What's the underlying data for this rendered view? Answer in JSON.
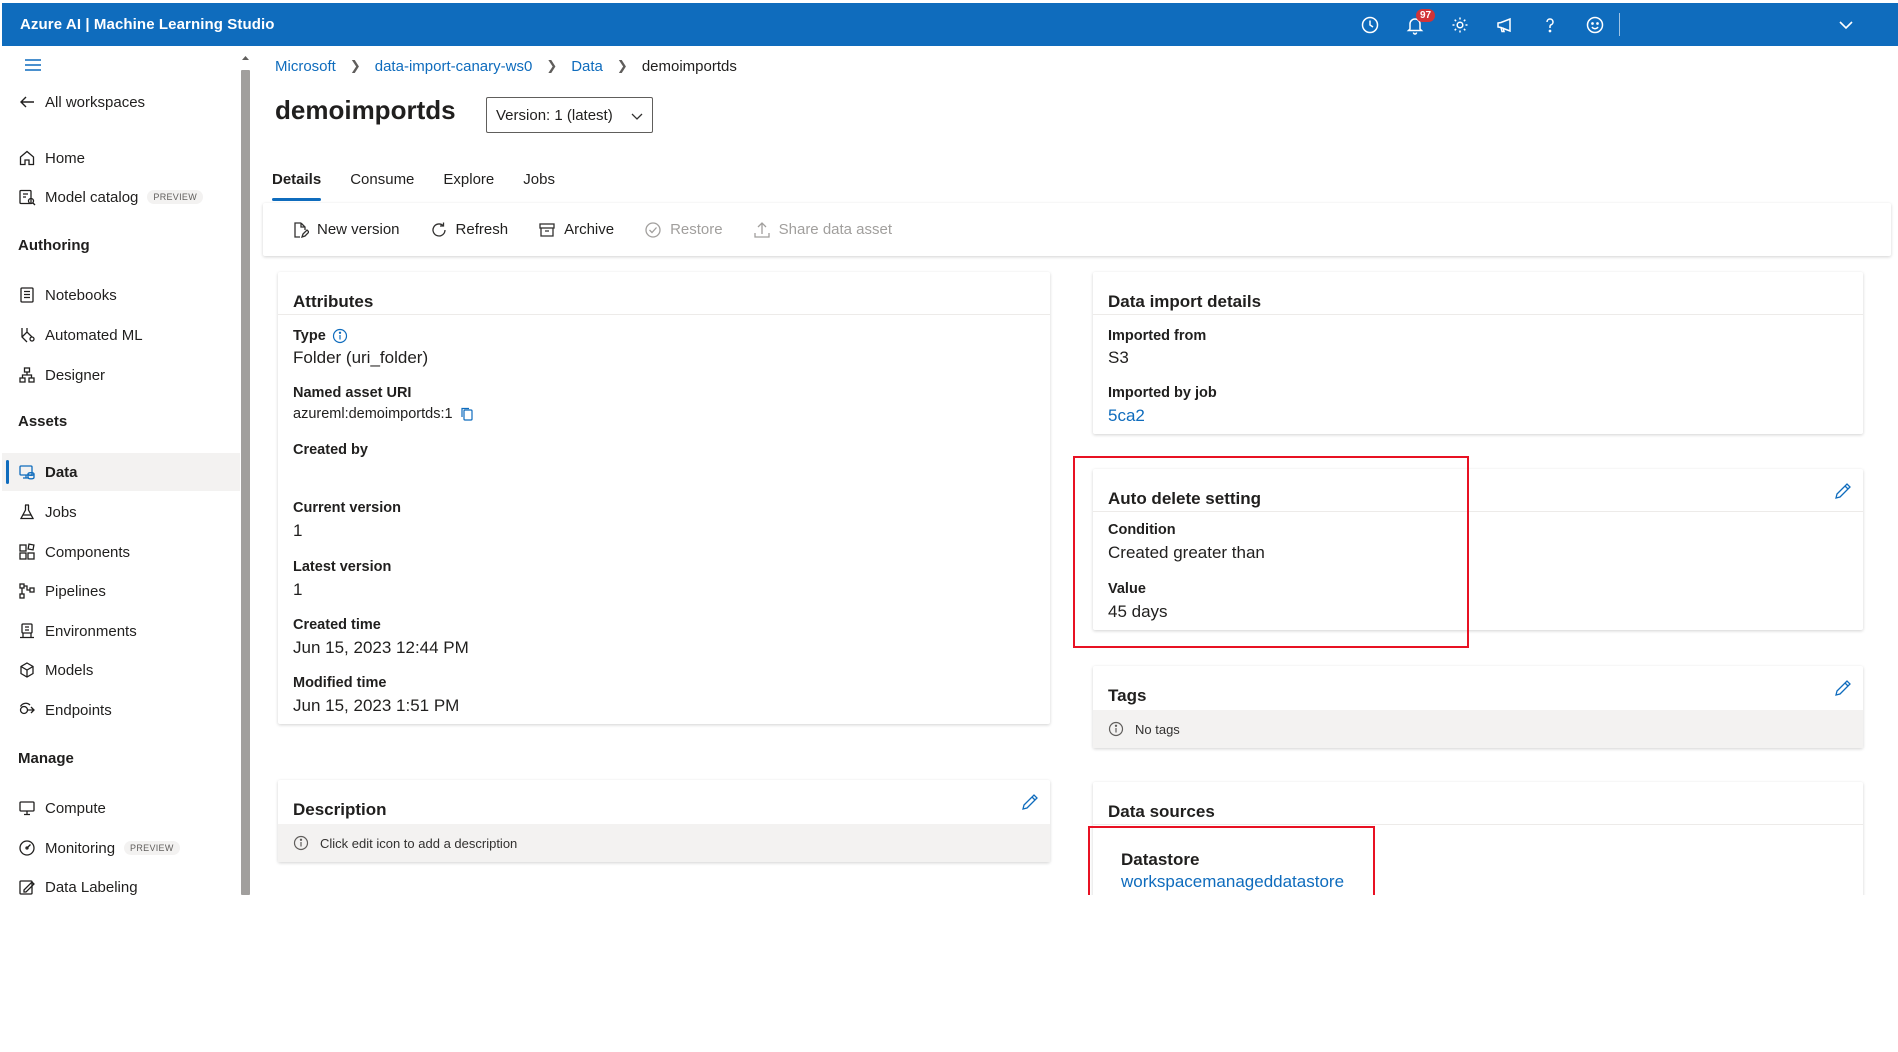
{
  "app": {
    "title": "Azure AI | Machine Learning Studio",
    "notification_count": "97"
  },
  "sidebar": {
    "back_label": "All workspaces",
    "top_items": [
      {
        "label": "Home",
        "icon": "home-icon"
      },
      {
        "label": "Model catalog",
        "icon": "model-catalog-icon",
        "badge": "PREVIEW"
      }
    ],
    "sections": [
      {
        "heading": "Authoring",
        "items": [
          "Notebooks",
          "Automated ML",
          "Designer"
        ]
      },
      {
        "heading": "Assets",
        "items": [
          "Data",
          "Jobs",
          "Components",
          "Pipelines",
          "Environments",
          "Models",
          "Endpoints"
        ]
      },
      {
        "heading": "Manage",
        "items": [
          "Compute",
          "Monitoring",
          "Data Labeling"
        ]
      }
    ],
    "monitoring_badge": "PREVIEW",
    "active_item": "Data"
  },
  "breadcrumb": [
    "Microsoft",
    "data-import-canary-ws0",
    "Data",
    "demoimportds"
  ],
  "page": {
    "title": "demoimportds",
    "version_selected": "Version: 1 (latest)"
  },
  "tabs": [
    "Details",
    "Consume",
    "Explore",
    "Jobs"
  ],
  "active_tab": "Details",
  "toolbar": {
    "new_version": "New version",
    "refresh": "Refresh",
    "archive": "Archive",
    "restore": "Restore",
    "share": "Share data asset"
  },
  "attributes": {
    "title": "Attributes",
    "type_label": "Type",
    "type_value": "Folder (uri_folder)",
    "uri_label": "Named asset URI",
    "uri_value": "azureml:demoimportds:1",
    "created_by_label": "Created by",
    "created_by_value": "",
    "current_version_label": "Current version",
    "current_version_value": "1",
    "latest_version_label": "Latest version",
    "latest_version_value": "1",
    "created_time_label": "Created time",
    "created_time_value": "Jun 15, 2023 12:44 PM",
    "modified_time_label": "Modified time",
    "modified_time_value": "Jun 15, 2023 1:51 PM"
  },
  "description": {
    "title": "Description",
    "placeholder": "Click edit icon to add a description"
  },
  "import_details": {
    "title": "Data import details",
    "imported_from_label": "Imported from",
    "imported_from_value": "S3",
    "imported_by_job_label": "Imported by job",
    "imported_by_job_value": "5ca2"
  },
  "auto_delete": {
    "title": "Auto delete setting",
    "condition_label": "Condition",
    "condition_value": "Created greater than",
    "value_label": "Value",
    "value_value": "45 days"
  },
  "tags": {
    "title": "Tags",
    "empty": "No tags"
  },
  "data_sources": {
    "title": "Data sources",
    "datastore_label": "Datastore",
    "datastore_value": "workspacemanageddatastore"
  },
  "colors": {
    "brand": "#0f6cbd",
    "highlight": "#e81123",
    "badge": "#d13438"
  }
}
